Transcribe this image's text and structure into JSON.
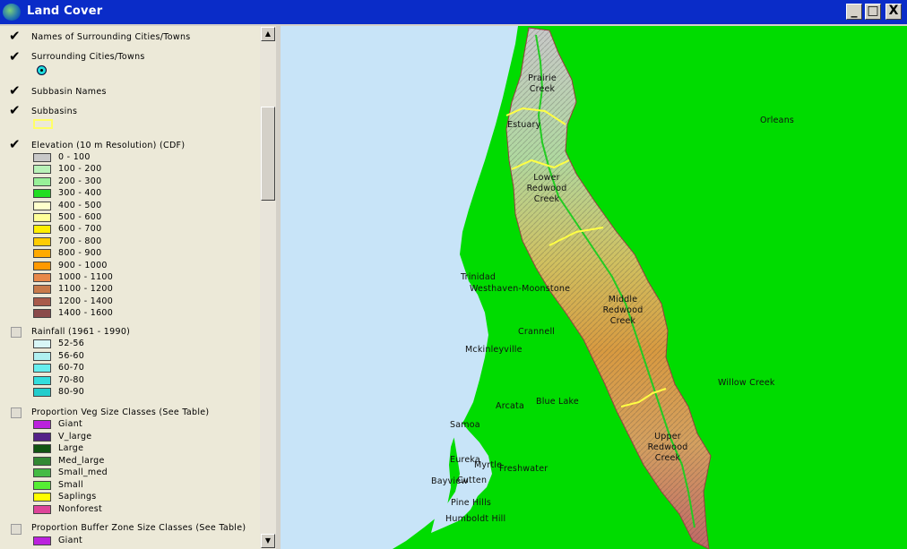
{
  "window": {
    "title": "Land Cover",
    "minimize_glyph": "_",
    "maximize_glyph": "□",
    "close_glyph": "X"
  },
  "toc": {
    "layers": {
      "names_cities": {
        "label": "Names of Surrounding Cities/Towns",
        "checked": true
      },
      "cities": {
        "label": "Surrounding Cities/Towns",
        "checked": true,
        "symbol": "target-dot"
      },
      "subbasin_names": {
        "label": "Subbasin Names",
        "checked": true
      },
      "subbasins": {
        "label": "Subbasins",
        "checked": true,
        "symbol_color": "#ffff66"
      },
      "elevation": {
        "label": "Elevation (10 m Resolution) (CDF)",
        "checked": true
      },
      "rainfall": {
        "label": "Rainfall (1961 - 1990)",
        "checked": false
      },
      "veg": {
        "label": "Proportion Veg Size Classes (See Table)",
        "checked": false
      },
      "buffer": {
        "label": "Proportion Buffer Zone Size Classes (See Table)",
        "checked": false
      }
    },
    "elevation_classes": [
      {
        "label": "0 - 100",
        "color": "#c8c8c8"
      },
      {
        "label": "100 - 200",
        "color": "#b8f2b8"
      },
      {
        "label": "200 - 300",
        "color": "#98f098"
      },
      {
        "label": "300 - 400",
        "color": "#22dd22"
      },
      {
        "label": "400 - 500",
        "color": "#ffffcc"
      },
      {
        "label": "500 - 600",
        "color": "#ffff99"
      },
      {
        "label": "600 - 700",
        "color": "#ffee00"
      },
      {
        "label": "700 - 800",
        "color": "#ffcc00"
      },
      {
        "label": "800 - 900",
        "color": "#ffaa00"
      },
      {
        "label": "900 - 1000",
        "color": "#ff9900"
      },
      {
        "label": "1000 - 1100",
        "color": "#e8884a"
      },
      {
        "label": "1100 - 1200",
        "color": "#c87a4a"
      },
      {
        "label": "1200 - 1400",
        "color": "#a85a4a"
      },
      {
        "label": "1400 - 1600",
        "color": "#8a4a4a"
      }
    ],
    "rainfall_classes": [
      {
        "label": "52-56",
        "color": "#d8f6f6"
      },
      {
        "label": "56-60",
        "color": "#b0f0f0"
      },
      {
        "label": "60-70",
        "color": "#66eeee"
      },
      {
        "label": "70-80",
        "color": "#33dddd"
      },
      {
        "label": "80-90",
        "color": "#22cccc"
      }
    ],
    "veg_classes": [
      {
        "label": "Giant",
        "color": "#bb22dd"
      },
      {
        "label": "V_large",
        "color": "#552288"
      },
      {
        "label": "Large",
        "color": "#115511"
      },
      {
        "label": "Med_large",
        "color": "#338833"
      },
      {
        "label": "Small_med",
        "color": "#44bb44"
      },
      {
        "label": "Small",
        "color": "#55ee33"
      },
      {
        "label": "Saplings",
        "color": "#ffff00"
      },
      {
        "label": "Nonforest",
        "color": "#dd4499"
      }
    ],
    "buffer_classes": [
      {
        "label": "Giant",
        "color": "#bb22dd"
      }
    ]
  },
  "map": {
    "land_color": "#00dc00",
    "water_color": "#c8e4f8",
    "subbasin_labels": {
      "prairie": "Prairie\nCreek",
      "estuary": "Estuary",
      "lower": "Lower\nRedwood\nCreek",
      "middle": "Middle\nRedwood\nCreek",
      "upper": "Upper\nRedwood\nCreek"
    },
    "towns": {
      "orleans": "Orleans",
      "trinidad": "Trinidad",
      "westhaven": "Westhaven-Moonstone",
      "crannell": "Crannell",
      "mckinleyville": "Mckinleyville",
      "willow_creek": "Willow Creek",
      "arcata": "Arcata",
      "blue_lake": "Blue Lake",
      "samoa": "Samoa",
      "eureka": "Eureka",
      "myrtle": "Myrtle",
      "freshwater": "Freshwater",
      "cutten": "Cutten",
      "bayview": "Bayview",
      "pine_hills": "Pine Hills",
      "humboldt_hill": "Humboldt Hill"
    }
  }
}
